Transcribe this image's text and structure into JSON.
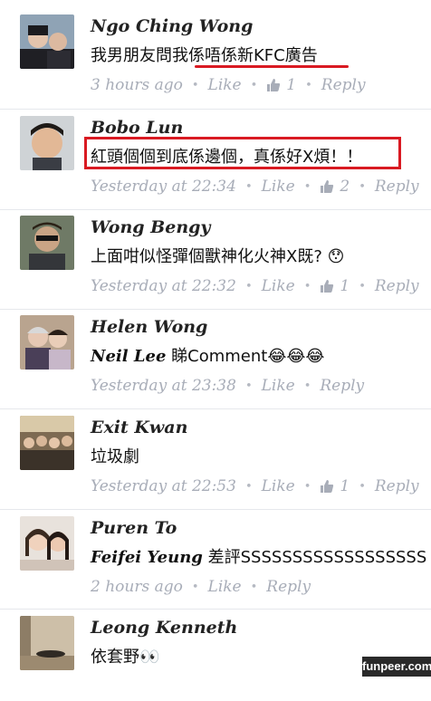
{
  "comments": [
    {
      "name": "Ngo Ching Wong",
      "text": "我男朋友問我係唔係新KFC廣告",
      "time": "3 hours ago",
      "like": "Like",
      "likes": "1",
      "reply": "Reply",
      "avatar": "avatar-photo-couple"
    },
    {
      "name": "Bobo Lun",
      "text": "紅頭個個到底係邊個，真係好X煩！！",
      "time": "Yesterday at 22:34",
      "like": "Like",
      "likes": "2",
      "reply": "Reply",
      "avatar": "avatar-photo-man"
    },
    {
      "name": "Wong Bengy",
      "text": "上面咁似怪彈個獸神化火神X既?",
      "emoji": "😯",
      "time": "Yesterday at 22:32",
      "like": "Like",
      "likes": "1",
      "reply": "Reply",
      "avatar": "avatar-photo-man-sunglasses"
    },
    {
      "name": "Helen Wong",
      "mention": "Neil Lee",
      "text": " 睇Comment",
      "emoji": "😂😂😂",
      "time": "Yesterday at 23:38",
      "like": "Like",
      "reply": "Reply",
      "avatar": "avatar-photo-women"
    },
    {
      "name": "Exit Kwan",
      "text": "垃圾劇",
      "time": "Yesterday at 22:53",
      "like": "Like",
      "likes": "1",
      "reply": "Reply",
      "avatar": "avatar-photo-group"
    },
    {
      "name": "Puren To",
      "mention": "Feifei Yeung",
      "text": " 差評SSSSSSSSSSSSSSSSSS",
      "time": "2 hours ago",
      "like": "Like",
      "reply": "Reply",
      "avatar": "avatar-photo-two-women"
    },
    {
      "name": "Leong Kenneth",
      "text": "依套野",
      "emoji": "👀",
      "avatar": "avatar-photo-room"
    }
  ],
  "watermark": "funpeer.com",
  "colors": {
    "meta": "#a8adb8",
    "highlight": "#d91a22",
    "name": "#222222"
  }
}
